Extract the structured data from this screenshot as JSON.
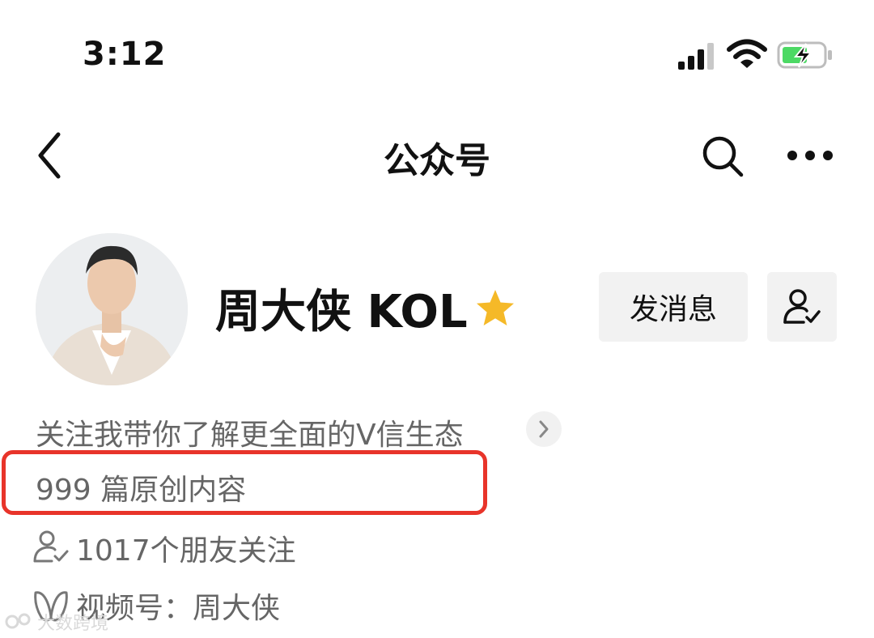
{
  "status_bar": {
    "time": "3:12",
    "icons": [
      "signal-icon",
      "wifi-icon",
      "battery-charging-icon"
    ]
  },
  "nav": {
    "title": "公众号",
    "icons": [
      "back-chevron-icon",
      "search-icon",
      "more-icon"
    ]
  },
  "profile": {
    "name": "周大侠 KOL",
    "badge_icon": "star-icon",
    "badge_color": "#f5b928",
    "message_button": "发消息",
    "follow_icon": "user-check-icon",
    "description": "关注我带你了解更全面的V信生态",
    "articles": "999 篇原创内容",
    "friends_following": "1017个朋友关注",
    "channels": "视频号：周大侠"
  },
  "highlight_color": "#e8342a",
  "watermark": "大数跨境"
}
